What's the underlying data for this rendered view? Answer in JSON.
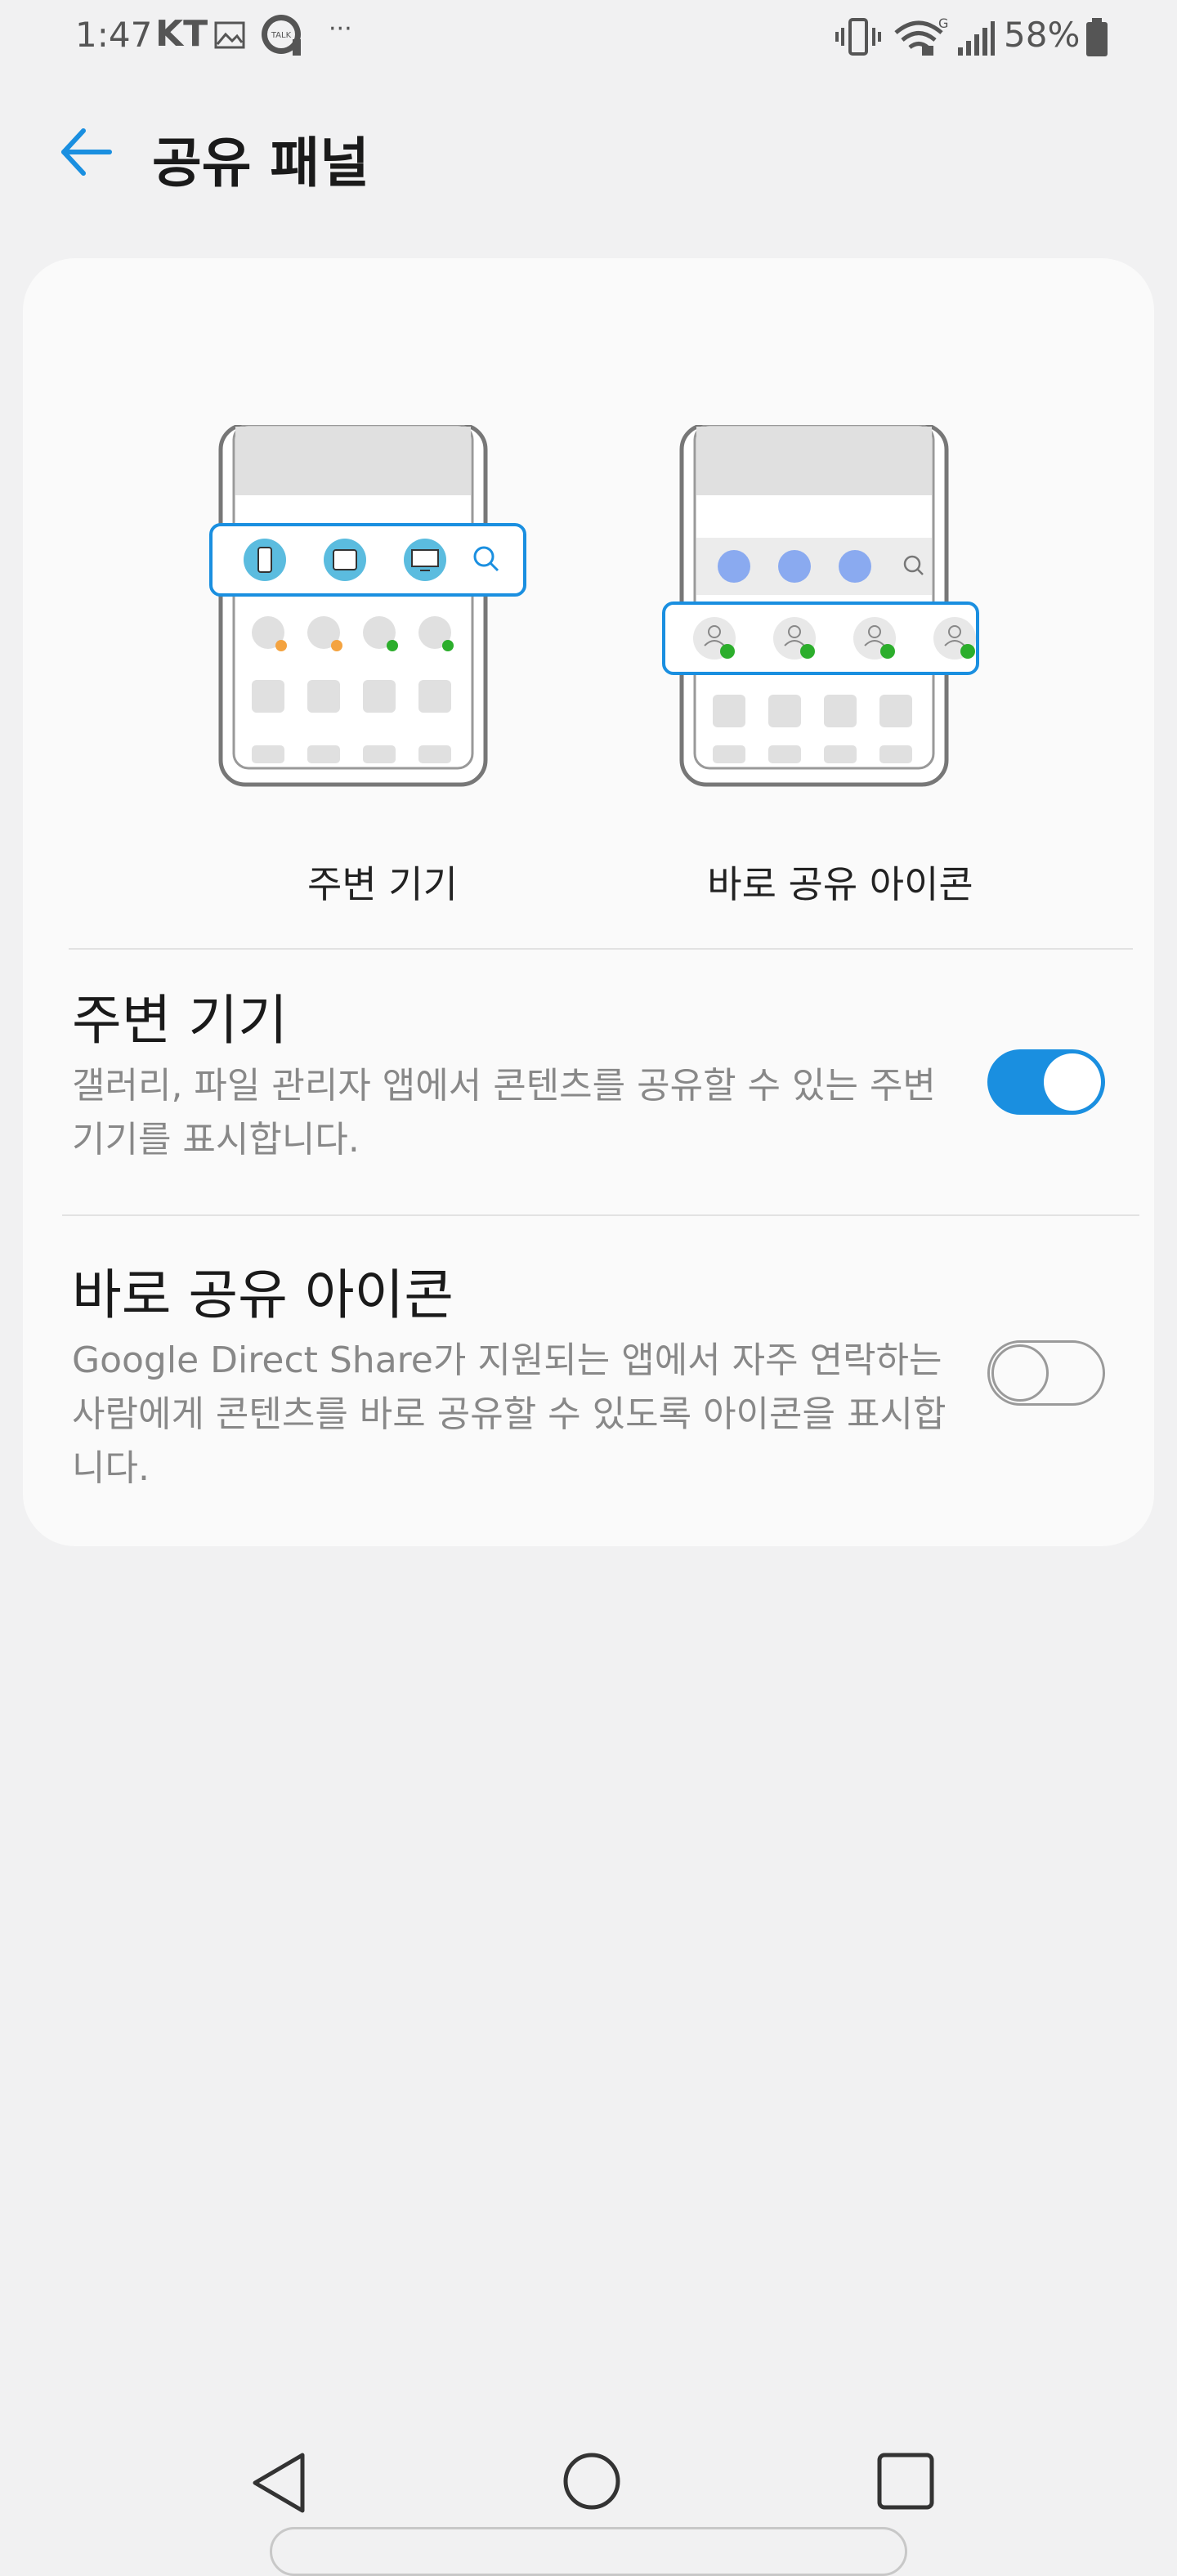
{
  "status_bar": {
    "time": "1:47",
    "carrier": "KT",
    "talk_badge": "TALK",
    "more": "···",
    "battery": "58%"
  },
  "header": {
    "title": "공유 패널"
  },
  "illustrations": {
    "nearby_label": "주변 기기",
    "direct_label": "바로 공유 아이콘"
  },
  "settings": [
    {
      "title": "주변 기기",
      "description": "갤러리, 파일 관리자 앱에서 콘텐츠를 공유할 수 있는 주변 기기를 표시합니다.",
      "enabled": true
    },
    {
      "title": "바로 공유 아이콘",
      "description": "Google Direct Share가 지원되는 앱에서 자주 연락하는 사람에게 콘텐츠를 바로 공유할 수 있도록 아이콘을 표시합니다.",
      "enabled": false
    }
  ],
  "colors": {
    "accent": "#1a8fe0",
    "background": "#f1f1f2",
    "card": "#fafafa"
  }
}
